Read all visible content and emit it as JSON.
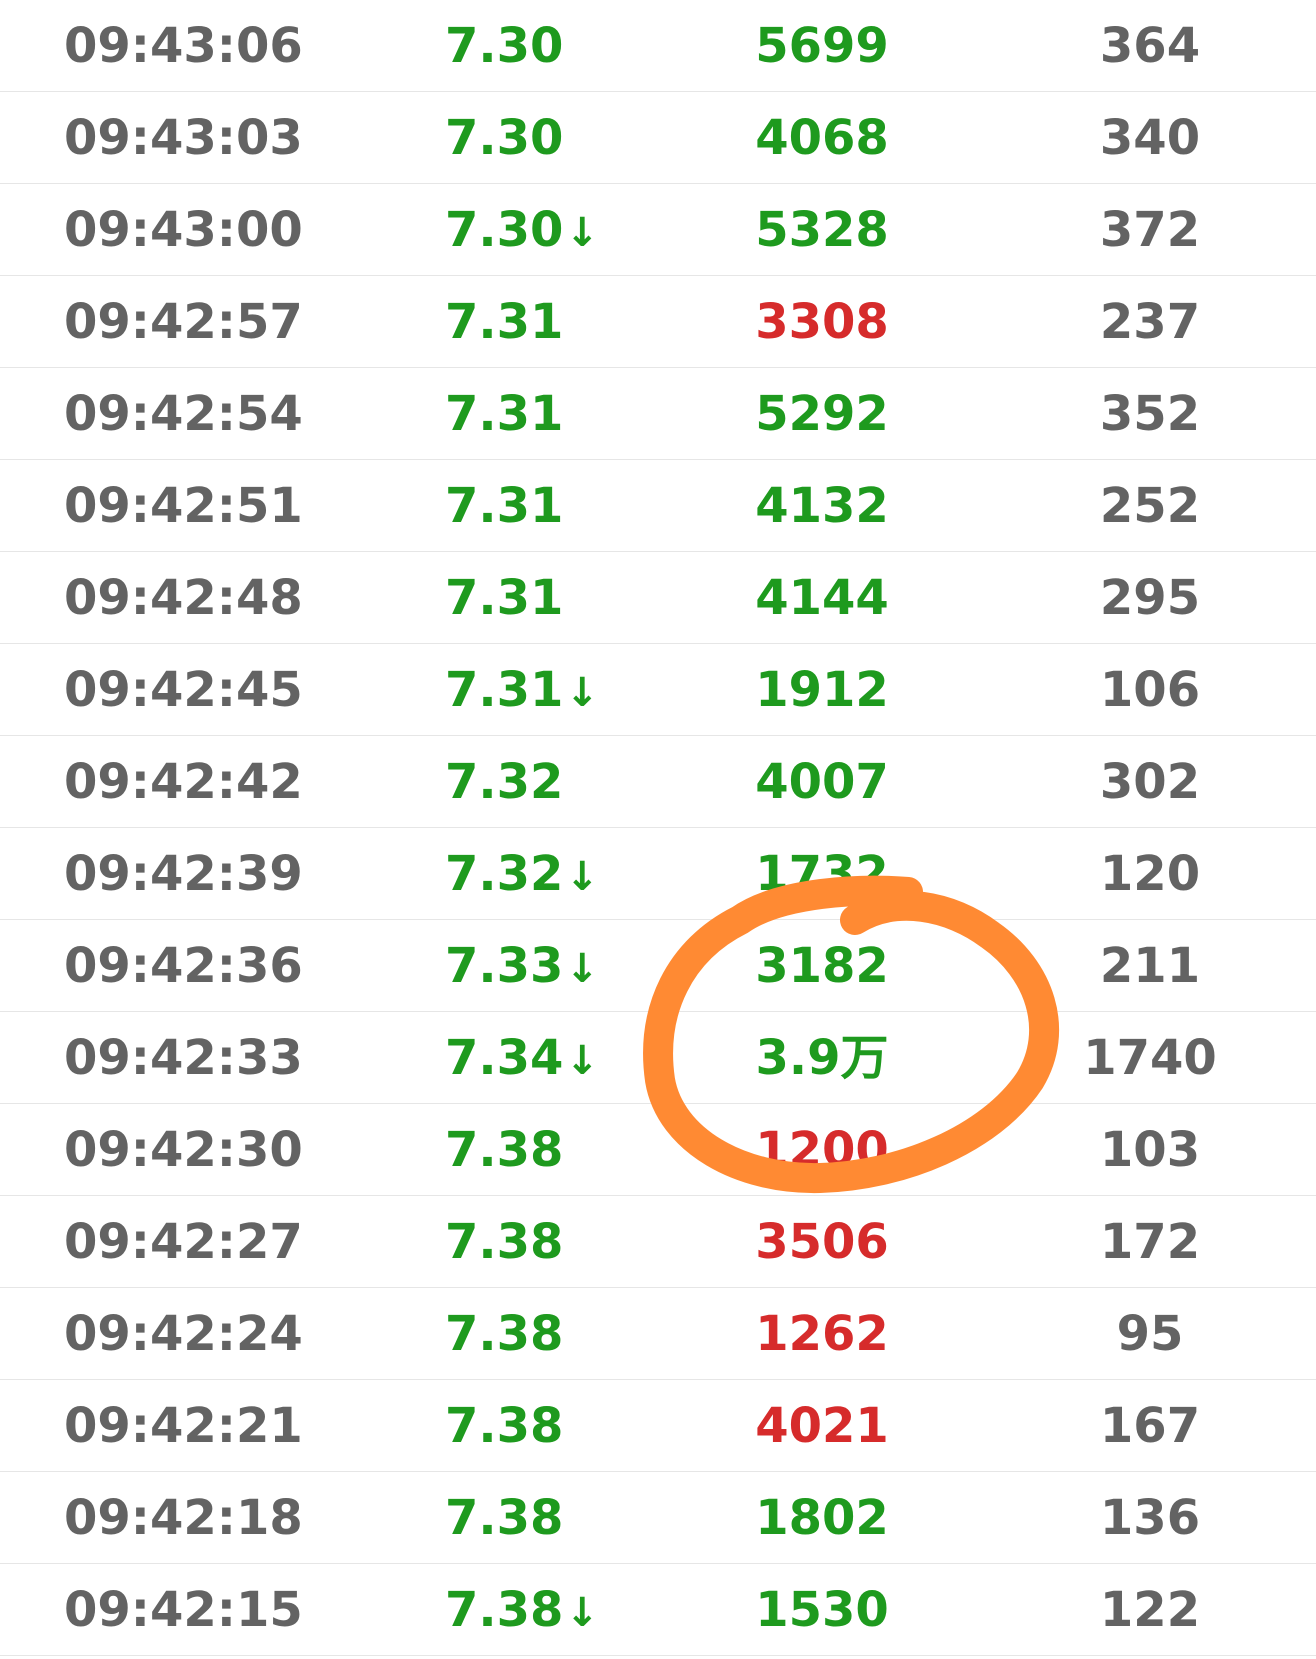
{
  "accent_colors": {
    "down": "#1e9a1e",
    "up": "#d62b2b",
    "neutral": "#636363",
    "annotation": "#ff8a33"
  },
  "rows": [
    {
      "time": "09:43:06",
      "price": "7.30",
      "arrow": "",
      "volume": "5699",
      "volume_dir": "green",
      "count": "364"
    },
    {
      "time": "09:43:03",
      "price": "7.30",
      "arrow": "",
      "volume": "4068",
      "volume_dir": "green",
      "count": "340"
    },
    {
      "time": "09:43:00",
      "price": "7.30",
      "arrow": "↓",
      "volume": "5328",
      "volume_dir": "green",
      "count": "372"
    },
    {
      "time": "09:42:57",
      "price": "7.31",
      "arrow": "",
      "volume": "3308",
      "volume_dir": "red",
      "count": "237"
    },
    {
      "time": "09:42:54",
      "price": "7.31",
      "arrow": "",
      "volume": "5292",
      "volume_dir": "green",
      "count": "352"
    },
    {
      "time": "09:42:51",
      "price": "7.31",
      "arrow": "",
      "volume": "4132",
      "volume_dir": "green",
      "count": "252"
    },
    {
      "time": "09:42:48",
      "price": "7.31",
      "arrow": "",
      "volume": "4144",
      "volume_dir": "green",
      "count": "295"
    },
    {
      "time": "09:42:45",
      "price": "7.31",
      "arrow": "↓",
      "volume": "1912",
      "volume_dir": "green",
      "count": "106"
    },
    {
      "time": "09:42:42",
      "price": "7.32",
      "arrow": "",
      "volume": "4007",
      "volume_dir": "green",
      "count": "302"
    },
    {
      "time": "09:42:39",
      "price": "7.32",
      "arrow": "↓",
      "volume": "1732",
      "volume_dir": "green",
      "count": "120"
    },
    {
      "time": "09:42:36",
      "price": "7.33",
      "arrow": "↓",
      "volume": "3182",
      "volume_dir": "green",
      "count": "211"
    },
    {
      "time": "09:42:33",
      "price": "7.34",
      "arrow": "↓",
      "volume": "3.9万",
      "volume_dir": "green",
      "count": "1740"
    },
    {
      "time": "09:42:30",
      "price": "7.38",
      "arrow": "",
      "volume": "1200",
      "volume_dir": "red",
      "count": "103"
    },
    {
      "time": "09:42:27",
      "price": "7.38",
      "arrow": "",
      "volume": "3506",
      "volume_dir": "red",
      "count": "172"
    },
    {
      "time": "09:42:24",
      "price": "7.38",
      "arrow": "",
      "volume": "1262",
      "volume_dir": "red",
      "count": "95"
    },
    {
      "time": "09:42:21",
      "price": "7.38",
      "arrow": "",
      "volume": "4021",
      "volume_dir": "red",
      "count": "167"
    },
    {
      "time": "09:42:18",
      "price": "7.38",
      "arrow": "",
      "volume": "1802",
      "volume_dir": "green",
      "count": "136"
    },
    {
      "time": "09:42:15",
      "price": "7.38",
      "arrow": "↓",
      "volume": "1530",
      "volume_dir": "green",
      "count": "122"
    }
  ]
}
